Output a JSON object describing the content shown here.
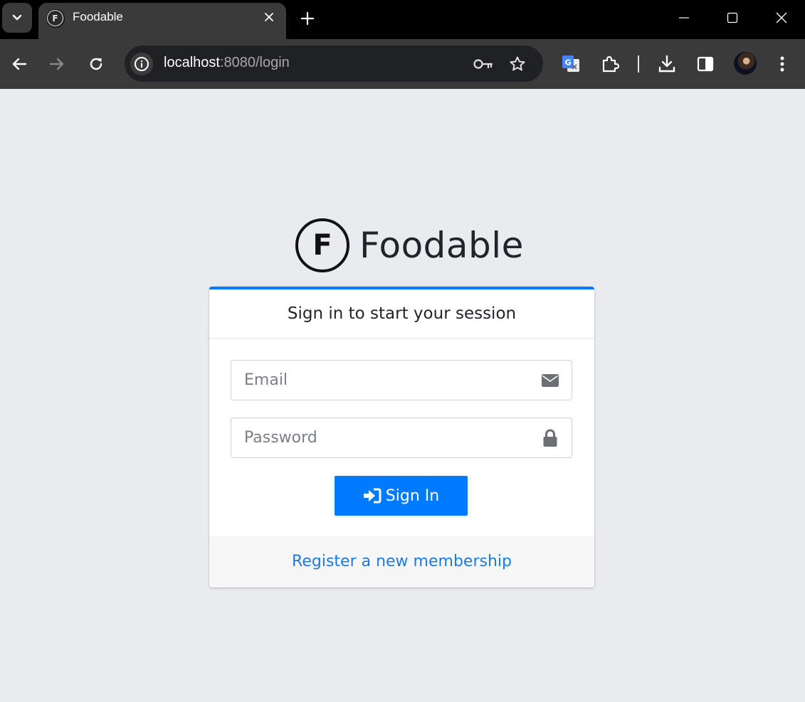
{
  "browser": {
    "tab": {
      "favicon_letter": "F",
      "title": "Foodable"
    },
    "address_bar": {
      "host": "localhost",
      "rest": ":8080/login"
    },
    "icons": {
      "tab_menu": "chevron-down-icon",
      "tab_close": "close-icon",
      "new_tab": "plus-icon",
      "minimize": "minimize-icon",
      "maximize": "maximize-icon",
      "close_window": "close-icon",
      "back": "arrow-left-icon",
      "forward": "arrow-right-icon",
      "reload": "reload-icon",
      "site_info": "info-icon",
      "password_key": "key-icon",
      "bookmark": "star-icon",
      "translate": "google-translate-icon",
      "extensions": "puzzle-icon",
      "downloads": "download-icon",
      "side_panel": "side-panel-icon",
      "profile": "avatar",
      "menu": "more-vertical-icon"
    },
    "colors": {
      "titlebar_bg": "#000000",
      "toolbar_bg": "#3a3a3a",
      "omnibox_bg": "#202124"
    }
  },
  "page": {
    "brand": {
      "logo_letter": "F",
      "name": "Foodable"
    },
    "login_card": {
      "header": "Sign in to start your session",
      "email_placeholder": "Email",
      "password_placeholder": "Password",
      "submit_label": "Sign In",
      "register_link": "Register a new membership",
      "icons": {
        "email": "envelope-icon",
        "password": "lock-icon",
        "submit": "sign-in-icon"
      }
    },
    "colors": {
      "background": "#e9ecef",
      "accent": "#007bff",
      "link": "#1f7ae0"
    }
  }
}
